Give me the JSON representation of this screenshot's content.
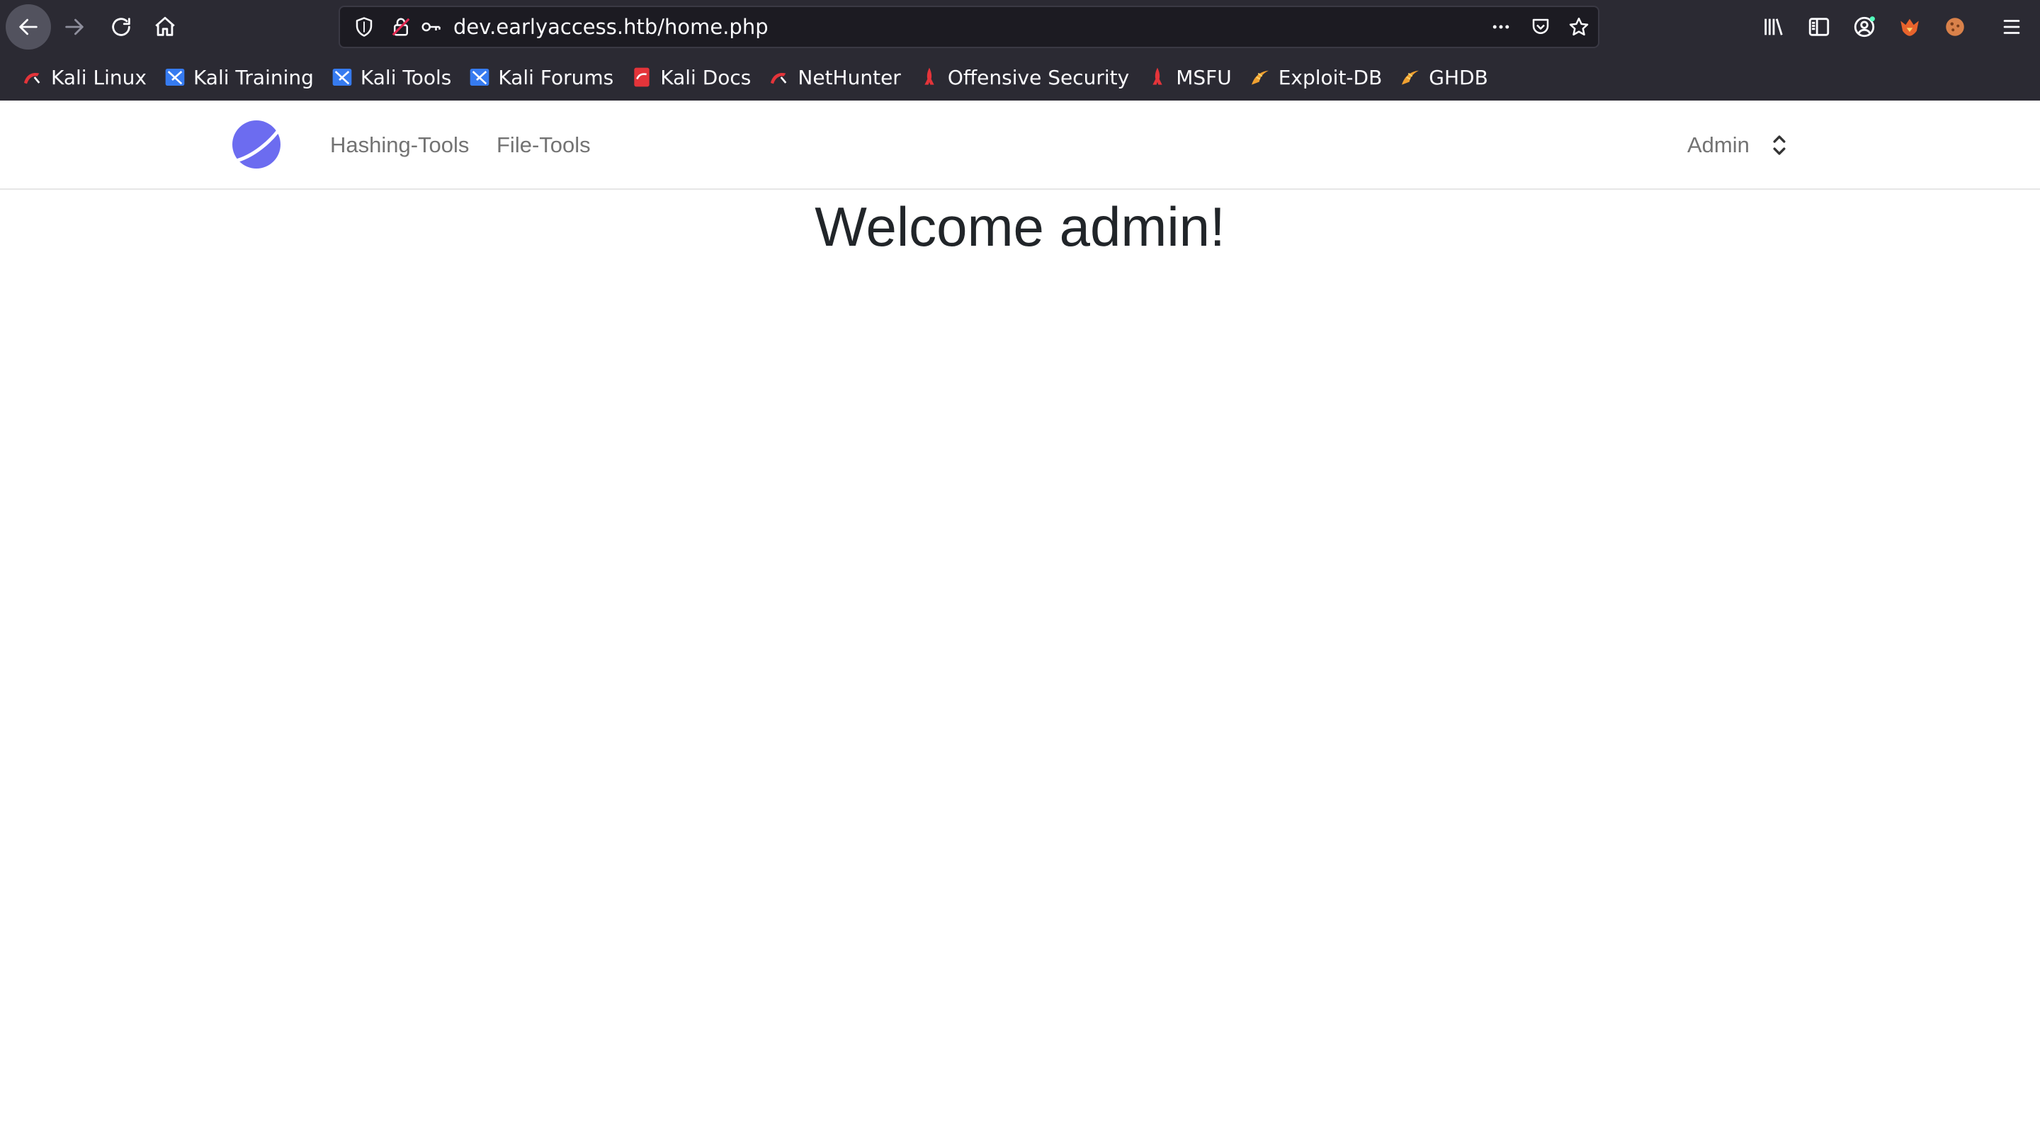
{
  "browser": {
    "url": "dev.earlyaccess.htb/home.php",
    "icons": {
      "back": "arrow-left-icon",
      "forward": "arrow-right-icon",
      "reload": "reload-icon",
      "home": "home-icon",
      "tracking_shield": "shield-icon",
      "insecure_lock": "insecure-lock-icon",
      "permissions_key": "key-icon",
      "page_actions": "more-horizontal-icon",
      "pocket": "pocket-icon",
      "bookmark_star": "star-icon",
      "library": "library-icon",
      "sidebar": "sidebar-icon",
      "account": "account-icon",
      "extension_1": "foxyproxy-icon",
      "extension_2": "cookie-icon",
      "app_menu": "hamburger-icon"
    },
    "bookmarks": [
      {
        "label": "Kali Linux",
        "icon": "kali-dragon-icon"
      },
      {
        "label": "Kali Training",
        "icon": "kali-tools-icon"
      },
      {
        "label": "Kali Tools",
        "icon": "kali-tools-icon"
      },
      {
        "label": "Kali Forums",
        "icon": "kali-tools-icon"
      },
      {
        "label": "Kali Docs",
        "icon": "kali-docs-icon"
      },
      {
        "label": "NetHunter",
        "icon": "kali-dragon-icon"
      },
      {
        "label": "Offensive Security",
        "icon": "offsec-icon"
      },
      {
        "label": "MSFU",
        "icon": "offsec-icon"
      },
      {
        "label": "Exploit-DB",
        "icon": "exploitdb-icon"
      },
      {
        "label": "GHDB",
        "icon": "exploitdb-icon"
      }
    ]
  },
  "site": {
    "nav": {
      "links": [
        "Hashing-Tools",
        "File-Tools"
      ],
      "user_menu": "Admin"
    },
    "heading": "Welcome admin!"
  },
  "colors": {
    "chrome_bg": "#2b2a33",
    "urlbar_bg": "#1c1b22",
    "logo": "#6c6cf0",
    "heading": "#212529",
    "nav_link": "#737373"
  }
}
